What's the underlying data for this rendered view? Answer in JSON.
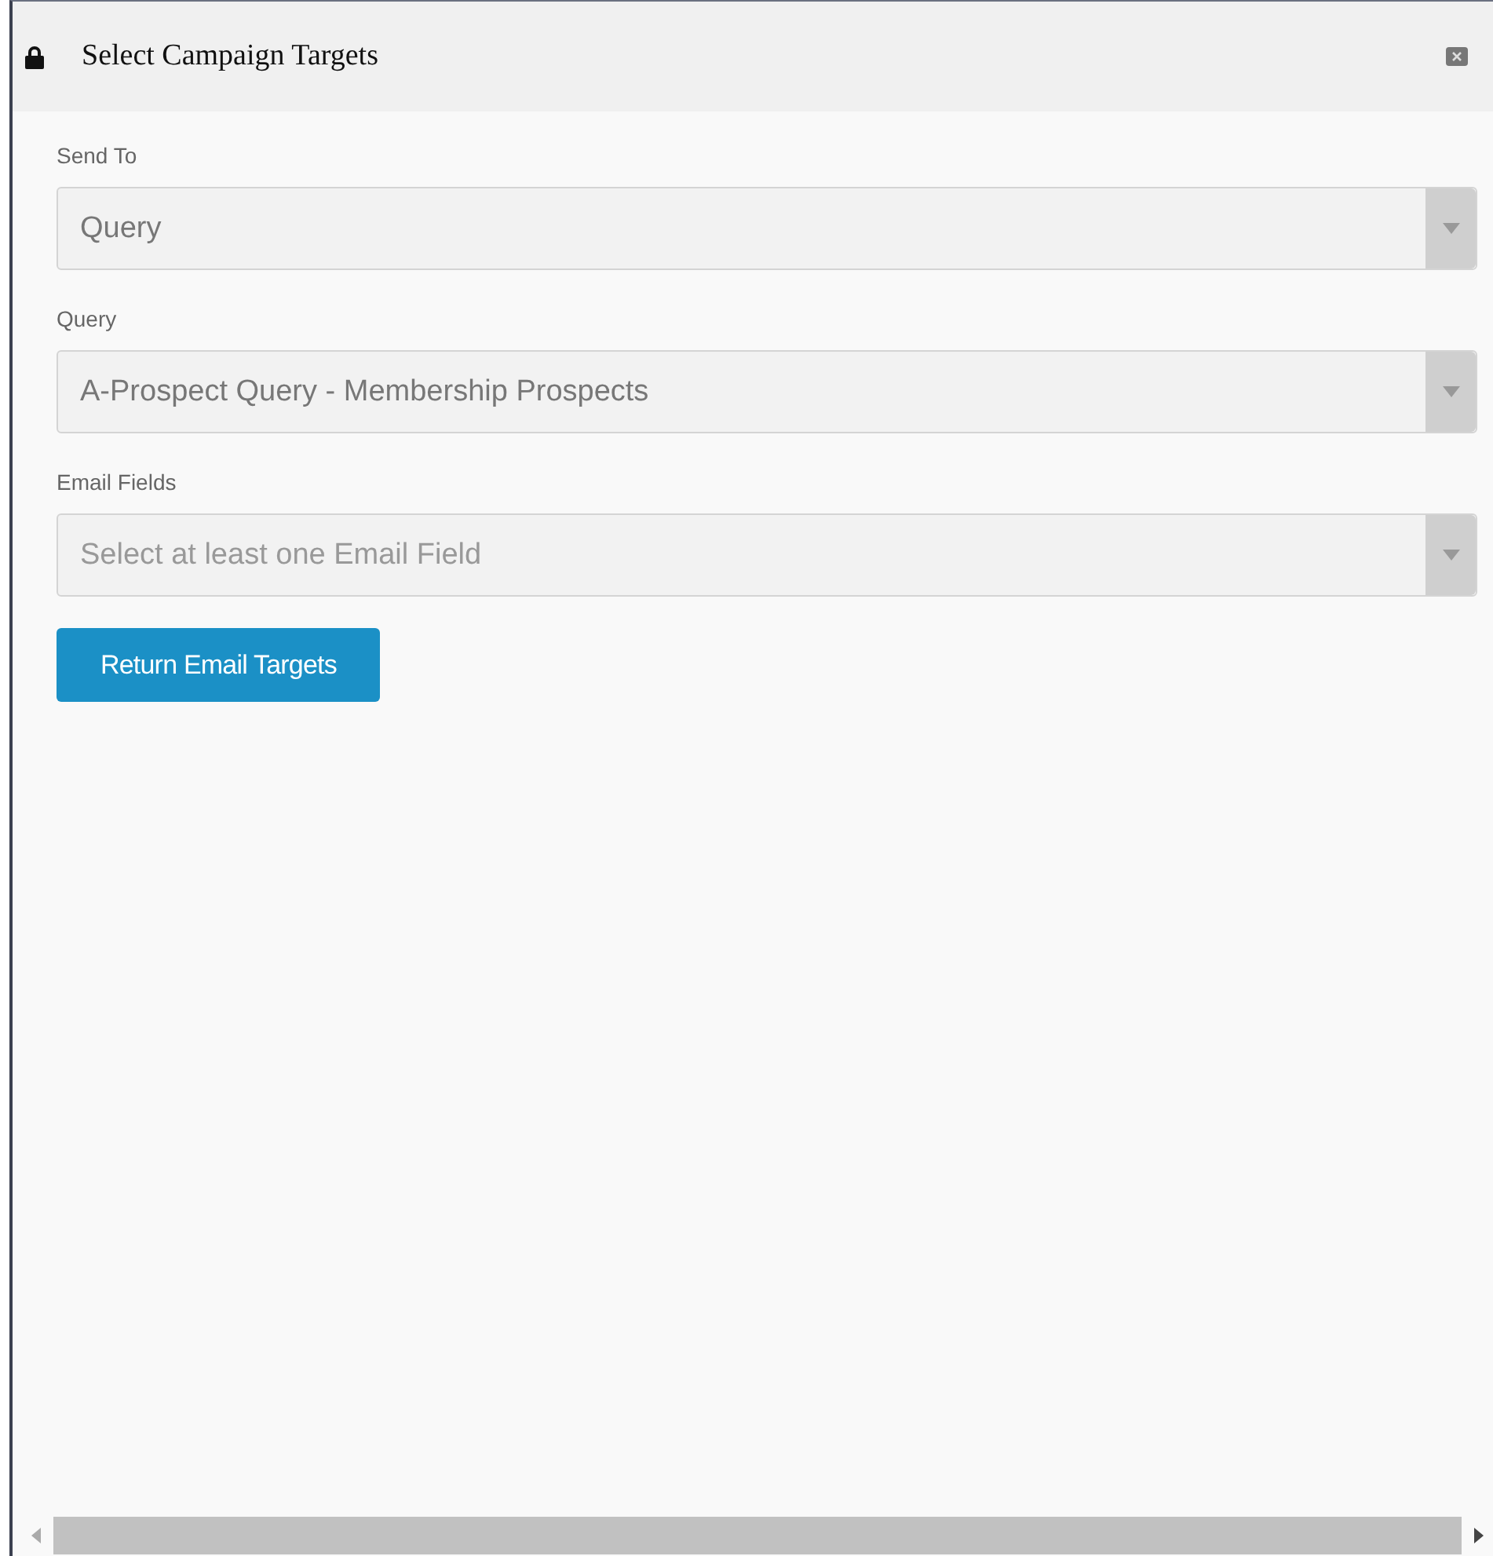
{
  "window": {
    "title": "Select Campaign Targets"
  },
  "fields": [
    {
      "label": "Send To",
      "value": "Query"
    },
    {
      "label": "Query",
      "value": "A-Prospect Query - Membership Prospects"
    },
    {
      "label": "Email Fields",
      "placeholder": "Select at least one Email Field"
    }
  ],
  "button": "Return Email Targets"
}
